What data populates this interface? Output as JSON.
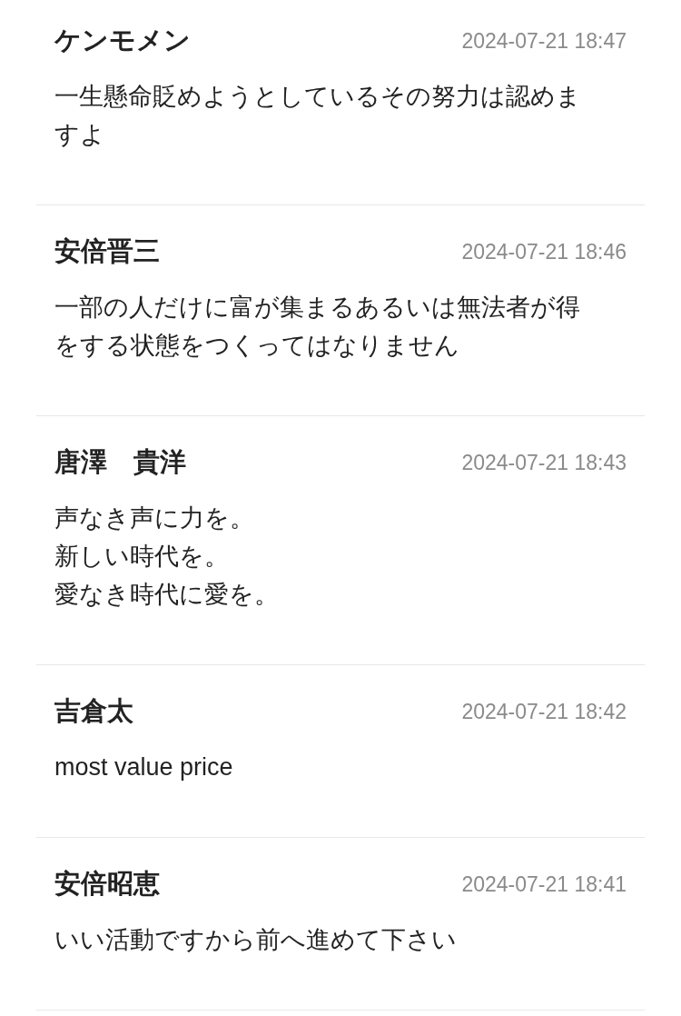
{
  "comments": [
    {
      "author": "ケンモメン",
      "time": "2024-07-21 18:47",
      "lines": [
        "一生懸命貶めようとしているその努力は認めますよ"
      ]
    },
    {
      "author": "安倍晋三",
      "time": "2024-07-21 18:46",
      "lines": [
        "一部の人だけに富が集まるあるいは無法者が得をする状態をつくってはなりません"
      ]
    },
    {
      "author": "唐澤　貴洋",
      "time": "2024-07-21 18:43",
      "lines": [
        "声なき声に力を。",
        "新しい時代を。",
        "愛なき時代に愛を。"
      ]
    },
    {
      "author": "吉倉太",
      "time": "2024-07-21 18:42",
      "lines": [
        "most value price"
      ]
    },
    {
      "author": "安倍昭恵",
      "time": "2024-07-21 18:41",
      "lines": [
        "いい活動ですから前へ進めて下さい"
      ]
    }
  ]
}
